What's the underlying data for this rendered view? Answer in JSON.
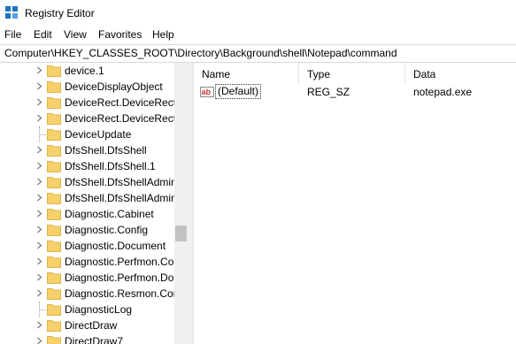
{
  "window": {
    "title": "Registry Editor",
    "icon": "registry-editor-icon"
  },
  "menu": {
    "items": [
      "File",
      "Edit",
      "View",
      "Favorites",
      "Help"
    ]
  },
  "address": {
    "path": "Computer\\HKEY_CLASSES_ROOT\\Directory\\Background\\shell\\Notepad\\command"
  },
  "tree": {
    "items": [
      {
        "label": "device.1",
        "expandable": true
      },
      {
        "label": "DeviceDisplayObject",
        "expandable": true
      },
      {
        "label": "DeviceRect.DeviceRect",
        "expandable": true
      },
      {
        "label": "DeviceRect.DeviceRect.",
        "expandable": true
      },
      {
        "label": "DeviceUpdate",
        "expandable": false
      },
      {
        "label": "DfsShell.DfsShell",
        "expandable": true
      },
      {
        "label": "DfsShell.DfsShell.1",
        "expandable": true
      },
      {
        "label": "DfsShell.DfsShellAdmin",
        "expandable": true
      },
      {
        "label": "DfsShell.DfsShellAdmin",
        "expandable": true
      },
      {
        "label": "Diagnostic.Cabinet",
        "expandable": true
      },
      {
        "label": "Diagnostic.Config",
        "expandable": true
      },
      {
        "label": "Diagnostic.Document",
        "expandable": true
      },
      {
        "label": "Diagnostic.Perfmon.Co",
        "expandable": true
      },
      {
        "label": "Diagnostic.Perfmon.Do",
        "expandable": true
      },
      {
        "label": "Diagnostic.Resmon.Cor",
        "expandable": true
      },
      {
        "label": "DiagnosticLog",
        "expandable": false
      },
      {
        "label": "DirectDraw",
        "expandable": true
      },
      {
        "label": "DirectDraw7",
        "expandable": true
      }
    ]
  },
  "list": {
    "columns": [
      "Name",
      "Type",
      "Data"
    ],
    "rows": [
      {
        "name": "(Default)",
        "type": "REG_SZ",
        "data": "notepad.exe",
        "icon": "string-value-icon"
      }
    ]
  },
  "colors": {
    "folder": "#f6d16b",
    "folder_edge": "#e0b548",
    "value_icon_red": "#d13438",
    "scroll_thumb": "#c2c2c2"
  }
}
